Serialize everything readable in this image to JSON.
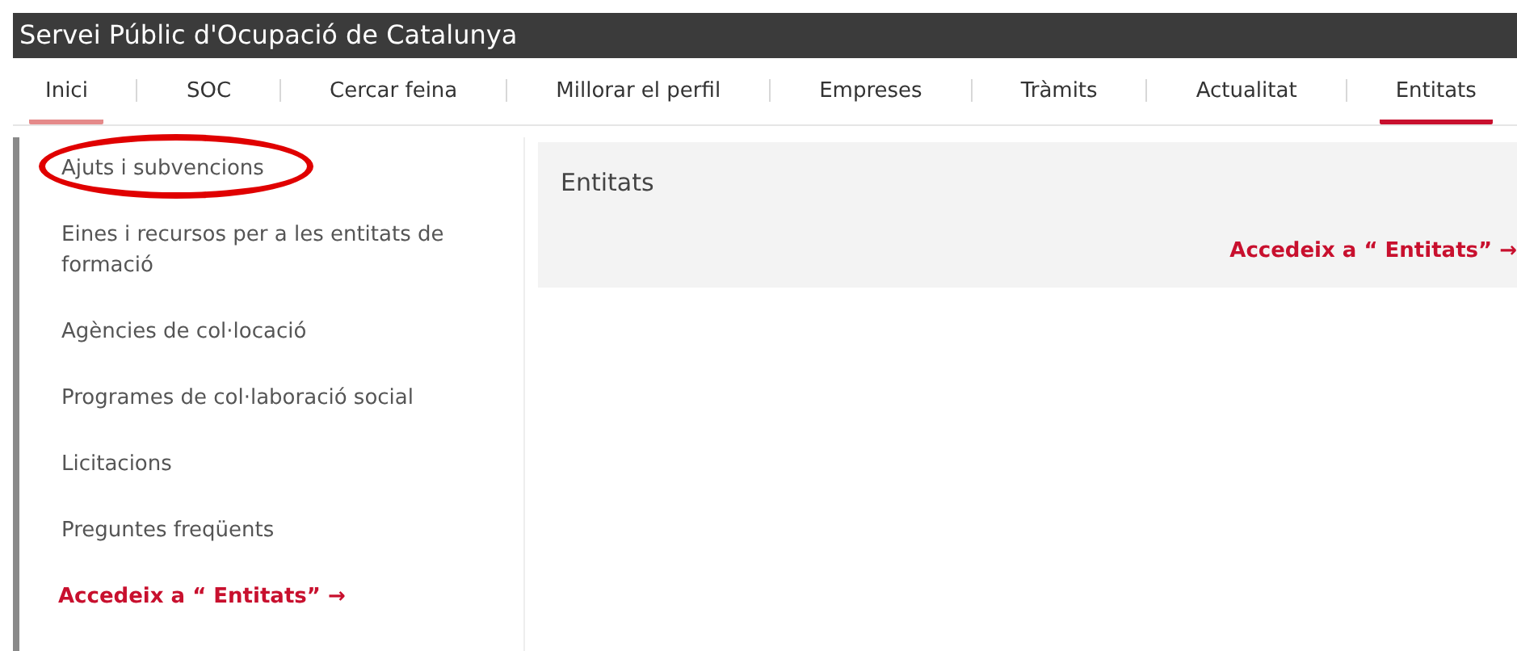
{
  "header": {
    "title": "Servei Públic d'Ocupació de Catalunya"
  },
  "tabs": [
    {
      "label": "Inici",
      "selected": false,
      "hovered": true
    },
    {
      "label": "SOC",
      "selected": false,
      "hovered": false
    },
    {
      "label": "Cercar feina",
      "selected": false,
      "hovered": false
    },
    {
      "label": "Millorar el perfil",
      "selected": false,
      "hovered": false
    },
    {
      "label": "Empreses",
      "selected": false,
      "hovered": false
    },
    {
      "label": "Tràmits",
      "selected": false,
      "hovered": false
    },
    {
      "label": "Actualitat",
      "selected": false,
      "hovered": false
    },
    {
      "label": "Entitats",
      "selected": true,
      "hovered": false
    }
  ],
  "sidebar": {
    "items": [
      {
        "label": "Ajuts i subvencions",
        "circled": true
      },
      {
        "label": "Eines i recursos per a les entitats de formació",
        "circled": false
      },
      {
        "label": "Agències de col·locació",
        "circled": false
      },
      {
        "label": "Programes de col·laboració social",
        "circled": false
      },
      {
        "label": "Licitacions",
        "circled": false
      },
      {
        "label": "Preguntes freqüents",
        "circled": false
      }
    ],
    "link": "Accedeix a “ Entitats” →"
  },
  "card": {
    "title": "Entitats",
    "link": "Accedeix a “ Entitats” →"
  }
}
